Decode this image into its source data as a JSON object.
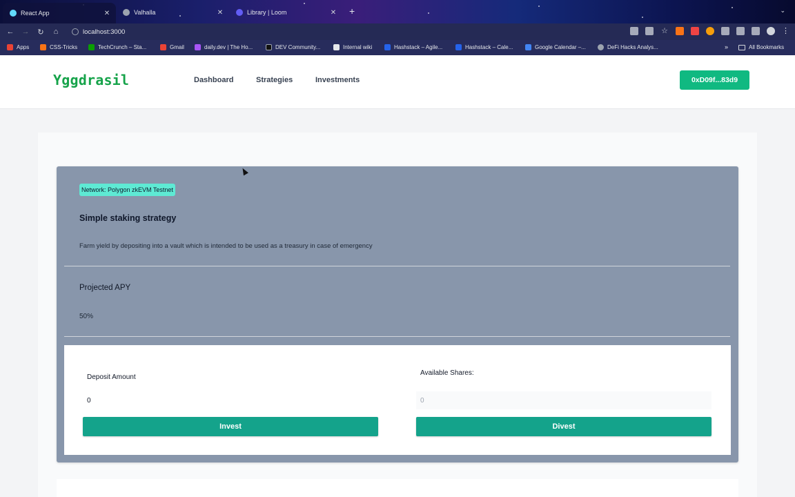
{
  "browser": {
    "tabs": [
      {
        "title": "React App",
        "favicon_color": "#61dafb",
        "active": true
      },
      {
        "title": "Valhalla",
        "favicon_color": "#9ca3af",
        "active": false
      },
      {
        "title": "Library | Loom",
        "favicon_color": "#625df5",
        "active": false
      }
    ],
    "url": "localhost:3000",
    "bookmarks": [
      {
        "label": "Apps",
        "color": "#ea4335"
      },
      {
        "label": "CSS-Tricks",
        "color": "#f97316"
      },
      {
        "label": "TechCrunch – Sta...",
        "color": "#0a9e01"
      },
      {
        "label": "Gmail",
        "color": "#ea4335"
      },
      {
        "label": "daily.dev | The Ho...",
        "color": "#a855f7"
      },
      {
        "label": "DEV Community...",
        "color": "#111111"
      },
      {
        "label": "Internal wiki",
        "color": "#e5e7eb"
      },
      {
        "label": "Hashstack – Agile...",
        "color": "#2563eb"
      },
      {
        "label": "Hashstack – Cale...",
        "color": "#2563eb"
      },
      {
        "label": "Google Calendar –...",
        "color": "#4285f4"
      },
      {
        "label": "DeFi Hacks Analys...",
        "color": "#9ca3af"
      }
    ],
    "more_label": "»",
    "all_bookmarks": "All Bookmarks"
  },
  "app": {
    "logo": "Yggdrasil",
    "nav": [
      "Dashboard",
      "Strategies",
      "Investments"
    ],
    "wallet": "0xD09f...83d9"
  },
  "strategy": {
    "network": "Network: Polygon zkEVM Testnet",
    "title": "Simple staking strategy",
    "description": "Farm yield by depositing into a vault which is intended to be used as a treasury in case of emergency",
    "apy_label": "Projected APY",
    "apy_value": "50%",
    "deposit_label": "Deposit Amount",
    "deposit_value": "0",
    "shares_label": "Available Shares:",
    "shares_value": "0",
    "invest_label": "Invest",
    "divest_label": "Divest"
  }
}
